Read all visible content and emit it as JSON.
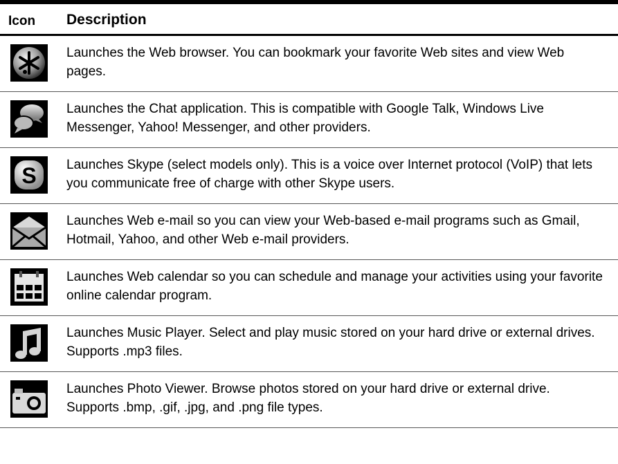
{
  "table": {
    "header": {
      "icon_col": "Icon",
      "desc_col": "Description"
    },
    "rows": [
      {
        "icon": "web-browser-icon",
        "description": "Launches the Web browser. You can bookmark your favorite Web sites and view Web pages."
      },
      {
        "icon": "chat-icon",
        "description": "Launches the Chat application. This is compatible with Google Talk, Windows Live Messenger, Yahoo! Messenger, and other providers."
      },
      {
        "icon": "skype-icon",
        "description": "Launches Skype (select models only). This is a voice over Internet protocol (VoIP) that lets you communicate free of charge with other Skype users."
      },
      {
        "icon": "web-email-icon",
        "description": "Launches Web e-mail so you can view your Web-based e-mail programs such as Gmail, Hotmail, Yahoo, and other Web e-mail providers."
      },
      {
        "icon": "web-calendar-icon",
        "description": "Launches Web calendar so you can schedule and manage your activities using your favorite online calendar program."
      },
      {
        "icon": "music-player-icon",
        "description": "Launches Music Player. Select and play music stored on your hard drive or external drives. Supports .mp3 files."
      },
      {
        "icon": "photo-viewer-icon",
        "description": "Launches Photo Viewer. Browse photos stored on your hard drive or external drive. Supports .bmp, .gif, .jpg, and .png file types."
      }
    ]
  }
}
